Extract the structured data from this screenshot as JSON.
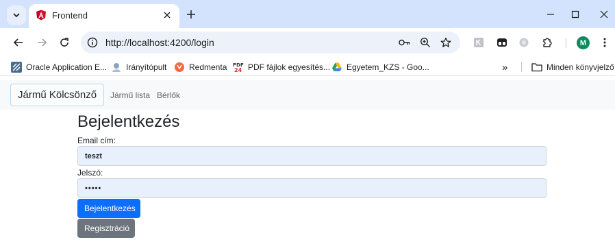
{
  "browser": {
    "tab": {
      "title": "Frontend"
    },
    "url": "http://localhost:4200/login",
    "profile_initial": "M",
    "bookmarks": [
      {
        "label": "Oracle Application E...",
        "icon": "oracle-icon"
      },
      {
        "label": "Irányítópult",
        "icon": "dashboard-icon"
      },
      {
        "label": "Redmenta",
        "icon": "redmenta-icon"
      },
      {
        "label": "PDF fájlok egyesítés...",
        "icon": "pdf-icon"
      },
      {
        "label": "Egyetem_KZS - Goo...",
        "icon": "google-drive-icon"
      }
    ],
    "bookmarks_overflow": "»",
    "all_bookmarks": "Minden könyvjelző",
    "colors": {
      "tabstrip": "#d3e3fd",
      "omnibox": "#edf2fa",
      "avatar": "#0f8a5f"
    }
  },
  "app": {
    "navbar": {
      "brand": "Jármű Kölcsönző",
      "links": [
        "Jármű lista",
        "Bérlők"
      ]
    },
    "login": {
      "title": "Bejelentkezés",
      "email_label": "Email cím:",
      "email_value": "teszt",
      "password_label": "Jelszó:",
      "password_value": "•••••",
      "login_button": "Bejelentkezés",
      "register_button": "Regisztráció"
    },
    "colors": {
      "primary": "#0d6efd",
      "secondary": "#6c757d",
      "input_bg": "#e8f0fe"
    }
  }
}
